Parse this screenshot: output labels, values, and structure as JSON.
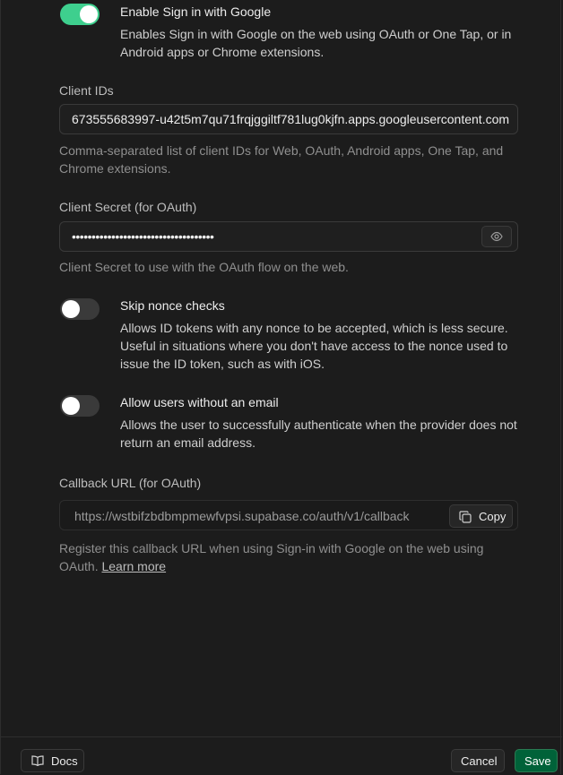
{
  "google_toggle": {
    "title": "Enable Sign in with Google",
    "description": "Enables Sign in with Google on the web using OAuth or One Tap, or in Android apps or Chrome extensions.",
    "enabled": true
  },
  "client_ids": {
    "label": "Client IDs",
    "value": "673555683997-u42t5m7qu71frqjggiltf781lug0kjfn.apps.googleusercontent.com",
    "help": "Comma-separated list of client IDs for Web, OAuth, Android apps, One Tap, and Chrome extensions."
  },
  "client_secret": {
    "label": "Client Secret (for OAuth)",
    "value": "••••••••••••••••••••••••••••••••••••",
    "help": "Client Secret to use with the OAuth flow on the web.",
    "reveal_icon": "eye-icon"
  },
  "skip_nonce": {
    "title": "Skip nonce checks",
    "description": "Allows ID tokens with any nonce to be accepted, which is less secure. Useful in situations where you don't have access to the nonce used to issue the ID token, such as with iOS.",
    "enabled": false
  },
  "allow_no_email": {
    "title": "Allow users without an email",
    "description": "Allows the user to successfully authenticate when the provider does not return an email address.",
    "enabled": false
  },
  "callback": {
    "label": "Callback URL (for OAuth)",
    "value": "https://wstbifzbdbmpmewfvpsi.supabase.co/auth/v1/callback",
    "copy_label": "Copy",
    "help_text": "Register this callback URL when using Sign-in with Google on the web using OAuth.",
    "learn_more": "Learn more"
  },
  "footer": {
    "docs_label": "Docs",
    "cancel_label": "Cancel",
    "save_label": "Save"
  },
  "colors": {
    "accent": "#3ecf8e",
    "save_bg": "#006239",
    "background": "#1c1c1c"
  }
}
